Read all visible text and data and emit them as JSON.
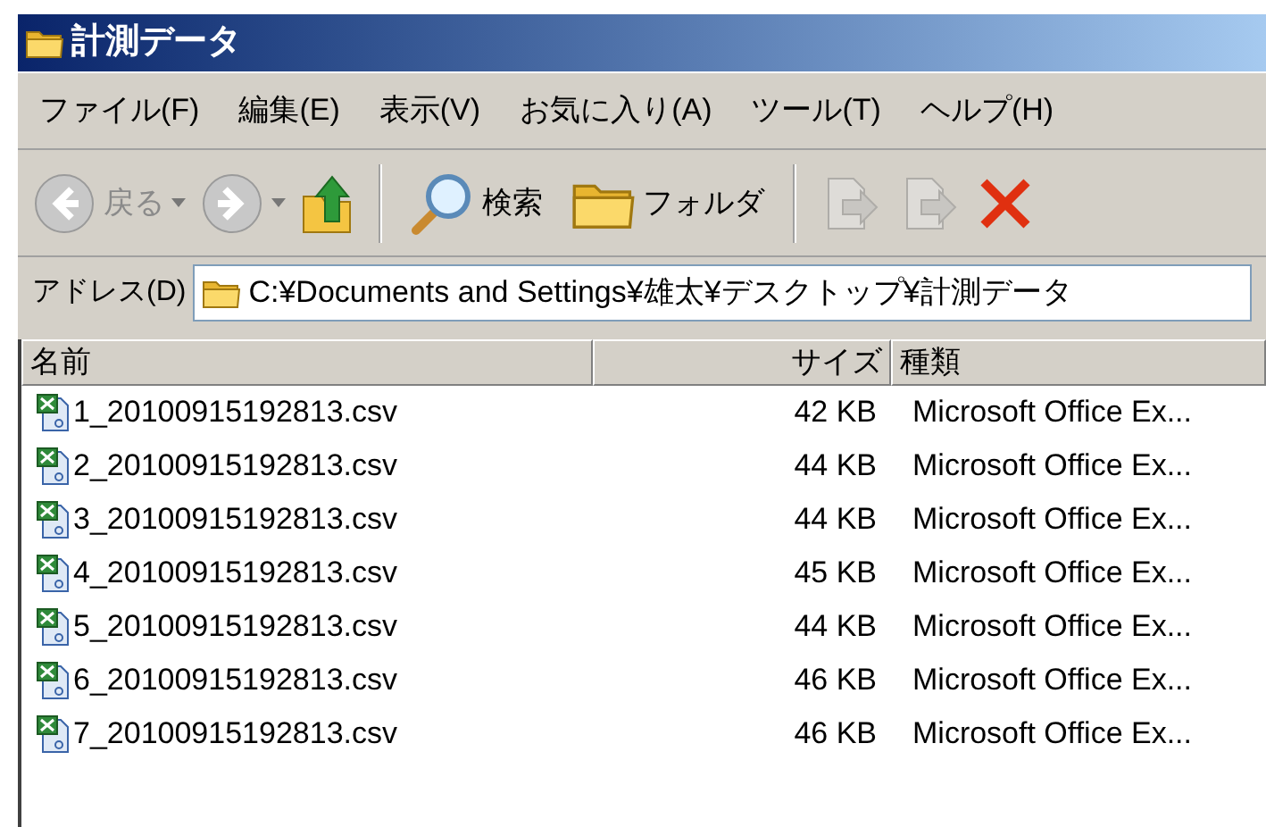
{
  "window": {
    "title": "計測データ"
  },
  "menu": [
    "ファイル(F)",
    "編集(E)",
    "表示(V)",
    "お気に入り(A)",
    "ツール(T)",
    "ヘルプ(H)"
  ],
  "toolbar": [
    {
      "kind": "back",
      "label": "戻る",
      "disabled": true
    },
    {
      "kind": "forward",
      "disabled": true
    },
    {
      "kind": "up",
      "disabled": false
    },
    {
      "kind": "separator"
    },
    {
      "kind": "search",
      "label": "検索",
      "disabled": false
    },
    {
      "kind": "folders",
      "label": "フォルダ",
      "disabled": false
    },
    {
      "kind": "separator"
    },
    {
      "kind": "move",
      "disabled": true
    },
    {
      "kind": "copy",
      "disabled": true
    },
    {
      "kind": "delete",
      "disabled": false
    }
  ],
  "address": {
    "label": "アドレス(D)",
    "value": "C:¥Documents and Settings¥雄太¥デスクトップ¥計測データ"
  },
  "table": {
    "columns": [
      "名前",
      "サイズ",
      "種類"
    ],
    "rows": [
      {
        "name": "1_20100915192813.csv",
        "size": "42 KB",
        "type": "Microsoft Office Ex..."
      },
      {
        "name": "2_20100915192813.csv",
        "size": "44 KB",
        "type": "Microsoft Office Ex..."
      },
      {
        "name": "3_20100915192813.csv",
        "size": "44 KB",
        "type": "Microsoft Office Ex..."
      },
      {
        "name": "4_20100915192813.csv",
        "size": "45 KB",
        "type": "Microsoft Office Ex..."
      },
      {
        "name": "5_20100915192813.csv",
        "size": "44 KB",
        "type": "Microsoft Office Ex..."
      },
      {
        "name": "6_20100915192813.csv",
        "size": "46 KB",
        "type": "Microsoft Office Ex..."
      },
      {
        "name": "7_20100915192813.csv",
        "size": "46 KB",
        "type": "Microsoft Office Ex..."
      }
    ]
  }
}
